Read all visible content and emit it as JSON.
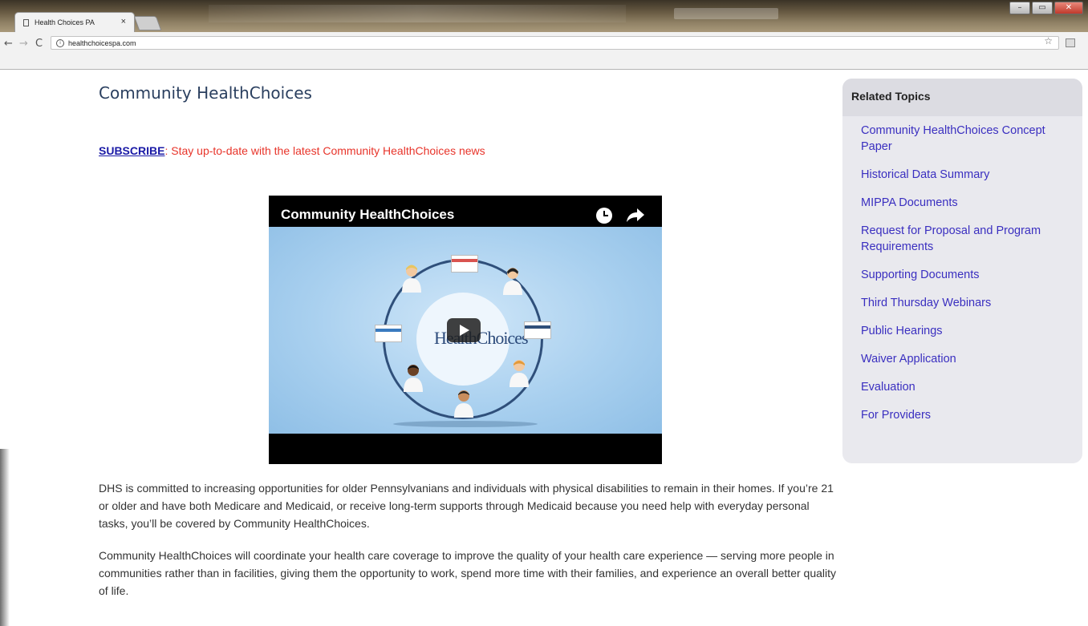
{
  "browser": {
    "tab_title": "Health Choices PA",
    "tab_close": "×",
    "url": "healthchoicespa.com",
    "back": "←",
    "forward": "→",
    "reload": "C",
    "star": "☆",
    "window_buttons": [
      "–",
      "▭",
      "✕"
    ]
  },
  "page": {
    "title": "Community HealthChoices",
    "subscribe_link": "SUBSCRIBE",
    "subscribe_text": ": Stay up-to-date with the latest Community HealthChoices news",
    "paragraphs": [
      "DHS is committed to increasing opportunities for older Pennsylvanians and individuals with physical disabilities to remain in their homes. If you’re 21 or older and have both Medicare and Medicaid, or receive long-term supports through Medicaid because you need help with everyday personal tasks, you’ll be covered by Community HealthChoices.",
      "Community HealthChoices will coordinate your health care coverage to improve the quality of your health care experience — serving more people in communities rather than in facilities, giving them the opportunity to work, spend more time with their families, and experience an overall better quality of life."
    ]
  },
  "video": {
    "title": "Community HealthChoices",
    "logo_text": "HealthChoices",
    "colors": {
      "ring": "#2f4f7a",
      "background": "#a9d0ef"
    }
  },
  "sidebar": {
    "heading": "Related Topics",
    "items": [
      "Community HealthChoices Concept Paper",
      "Historical Data Summary",
      "MIPPA Documents",
      "Request for Proposal and Program Requirements",
      "Supporting Documents",
      "Third Thursday Webinars",
      "Public Hearings",
      "Waiver Application",
      "Evaluation",
      "For Providers"
    ]
  },
  "colors": {
    "link": "#3a2fc0",
    "subscribe_link": "#1a1aa6",
    "subscribe_text": "#e8342a",
    "title": "#2a3f5f",
    "sidebar_bg": "#e9e9ee"
  }
}
